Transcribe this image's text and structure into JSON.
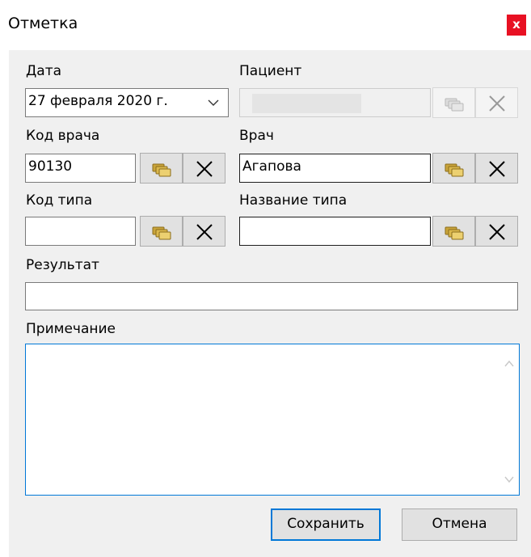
{
  "window": {
    "title": "Отметка",
    "close_label": "x"
  },
  "fields": {
    "date": {
      "label": "Дата",
      "value": "27 февраля  2020 г."
    },
    "patient": {
      "label": "Пациент",
      "value": ""
    },
    "doctor_code": {
      "label": "Код врача",
      "value": "90130"
    },
    "doctor": {
      "label": "Врач",
      "value": "Агапова"
    },
    "type_code": {
      "label": "Код типа",
      "value": ""
    },
    "type_name": {
      "label": "Название типа",
      "value": ""
    },
    "result": {
      "label": "Результат",
      "value": ""
    },
    "note": {
      "label": "Примечание",
      "value": ""
    }
  },
  "buttons": {
    "save": "Сохранить",
    "cancel": "Отмена"
  },
  "icons": {
    "pick": "folders-icon",
    "clear": "x-icon",
    "dropdown": "chevron-down-icon"
  },
  "colors": {
    "close_button": "#e81123",
    "focus_border": "#0078d7",
    "picker_yellow": "#e2c254"
  }
}
